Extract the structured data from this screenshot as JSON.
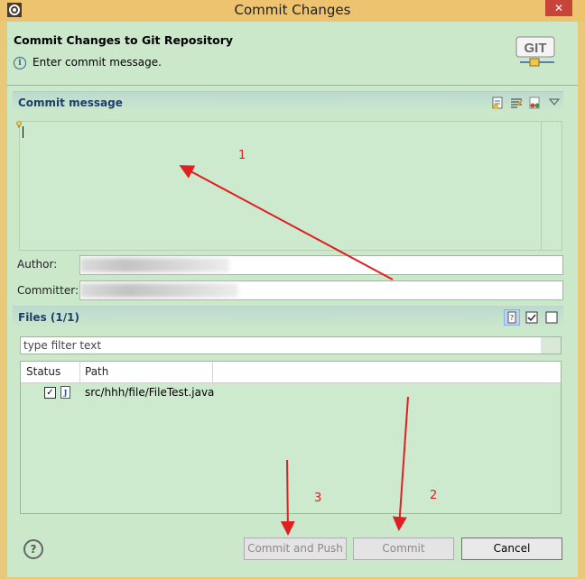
{
  "window": {
    "title": "Commit Changes",
    "close_label": "✕"
  },
  "header": {
    "title": "Commit Changes to Git Repository",
    "message": "Enter commit message.",
    "logo_text": "GIT"
  },
  "commit_message": {
    "section_title": "Commit message",
    "value": "",
    "tool_icons": [
      "spell-check-icon",
      "format-icon",
      "add-signed-off-icon",
      "dropdown-icon"
    ]
  },
  "author": {
    "label": "Author:",
    "value": ""
  },
  "committer": {
    "label": "Committer:",
    "value": ""
  },
  "files": {
    "section_title": "Files (1/1)",
    "filter_placeholder": "type filter text",
    "columns": [
      "Status",
      "Path"
    ],
    "rows": [
      {
        "checked": true,
        "icon": "java-file-icon",
        "path": "src/hhh/file/FileTest.java"
      }
    ]
  },
  "buttons": {
    "commit_and_push": "Commit and Push",
    "commit": "Commit",
    "cancel": "Cancel",
    "help": "?"
  },
  "annotations": [
    "1",
    "2",
    "3"
  ],
  "colors": {
    "dialog_bg": "#cbe8cb",
    "title_bar": "#edc36f",
    "annotation": "#e02020",
    "section_title": "#1f3f6b"
  }
}
